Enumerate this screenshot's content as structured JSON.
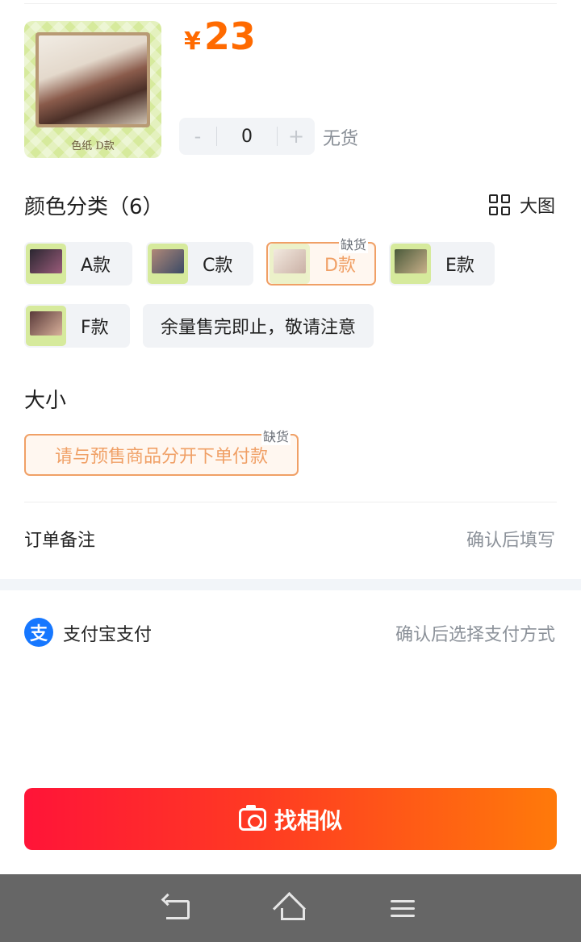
{
  "product": {
    "thumb_caption": "色纸 D款",
    "currency": "¥",
    "price": "23",
    "quantity": "0",
    "minus": "-",
    "plus": "+",
    "stock_status": "无货"
  },
  "color_section": {
    "title": "颜色分类（6）",
    "big_image_label": "大图",
    "options": [
      {
        "label": "A款",
        "available": true,
        "thumb_colors": [
          "#2a2630",
          "#9a5b7a"
        ]
      },
      {
        "label": "C款",
        "available": true,
        "thumb_colors": [
          "#b08878",
          "#3a4a66"
        ]
      },
      {
        "label": "D款",
        "available": false,
        "tag": "缺货",
        "thumb_colors": [
          "#e4d9cc",
          "#8a5b4b"
        ]
      },
      {
        "label": "E款",
        "available": true,
        "thumb_colors": [
          "#4a5a3a",
          "#c9b08a"
        ]
      },
      {
        "label": "F款",
        "available": true,
        "thumb_colors": [
          "#5a3a3a",
          "#d8b09a"
        ]
      },
      {
        "label": "余量售完即止，敬请注意",
        "available": true
      }
    ]
  },
  "size_section": {
    "title": "大小",
    "option_label": "请与预售商品分开下单付款",
    "option_tag": "缺货"
  },
  "order_note": {
    "label": "订单备注",
    "value": "确认后填写"
  },
  "payment": {
    "icon_char": "支",
    "label": "支付宝支付",
    "value": "确认后选择支付方式"
  },
  "cta": {
    "label": "找相似"
  },
  "colors": {
    "price": "#ff6a00",
    "accent_out_of_stock": "#f0a066",
    "alipay": "#1677ff",
    "cta_start": "#ff1438",
    "cta_end": "#ff7a0a"
  }
}
